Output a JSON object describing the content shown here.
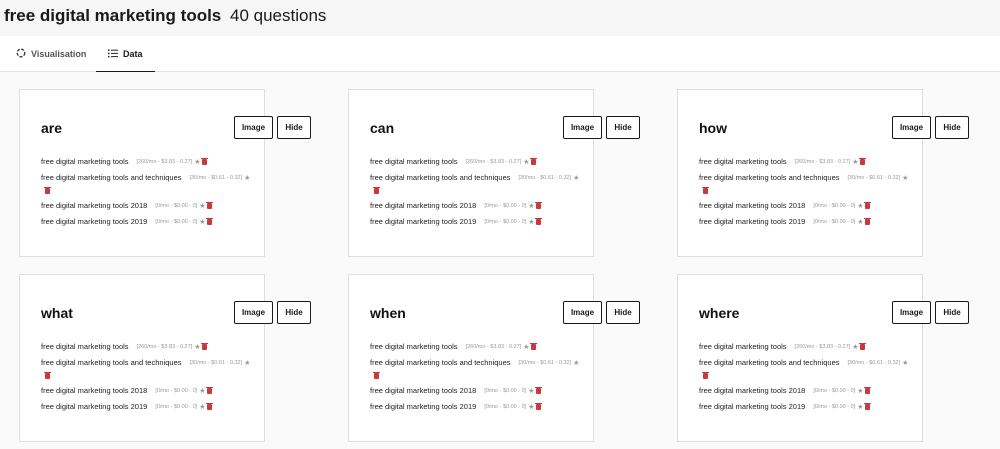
{
  "header": {
    "keyword": "free digital marketing tools",
    "count_label": "40 questions"
  },
  "tabs": [
    {
      "label": "Visualisation",
      "icon": "spinner-icon",
      "active": false
    },
    {
      "label": "Data",
      "icon": "list-icon",
      "active": true
    }
  ],
  "buttons": {
    "image": "Image",
    "hide": "Hide"
  },
  "cards": [
    {
      "title": "are",
      "rows": [
        {
          "text": "free digital marketing tools",
          "meta": "[260/mo - $3.83 - 0.27]"
        },
        {
          "text": "free digital marketing tools and techniques",
          "meta": "[30/mo - $0.61 - 0.32]"
        },
        {
          "text": "free digital marketing tools 2018",
          "meta": "[0/mo - $0.00 - 0]"
        },
        {
          "text": "free digital marketing tools 2019",
          "meta": "[0/mo - $0.00 - 0]"
        }
      ]
    },
    {
      "title": "can",
      "rows": [
        {
          "text": "free digital marketing tools",
          "meta": "[260/mo - $3.83 - 0.27]"
        },
        {
          "text": "free digital marketing tools and techniques",
          "meta": "[30/mo - $0.61 - 0.32]"
        },
        {
          "text": "free digital marketing tools 2018",
          "meta": "[0/mo - $0.00 - 0]"
        },
        {
          "text": "free digital marketing tools 2019",
          "meta": "[0/mo - $0.00 - 0]"
        }
      ]
    },
    {
      "title": "how",
      "rows": [
        {
          "text": "free digital marketing tools",
          "meta": "[260/mo - $3.83 - 0.27]"
        },
        {
          "text": "free digital marketing tools and techniques",
          "meta": "[30/mo - $0.61 - 0.32]"
        },
        {
          "text": "free digital marketing tools 2018",
          "meta": "[0/mo - $0.00 - 0]"
        },
        {
          "text": "free digital marketing tools 2019",
          "meta": "[0/mo - $0.00 - 0]"
        }
      ]
    },
    {
      "title": "what",
      "rows": [
        {
          "text": "free digital marketing tools",
          "meta": "[260/mo - $3.83 - 0.27]"
        },
        {
          "text": "free digital marketing tools and techniques",
          "meta": "[30/mo - $0.61 - 0.32]"
        },
        {
          "text": "free digital marketing tools 2018",
          "meta": "[0/mo - $0.00 - 0]"
        },
        {
          "text": "free digital marketing tools 2019",
          "meta": "[0/mo - $0.00 - 0]"
        }
      ]
    },
    {
      "title": "when",
      "rows": [
        {
          "text": "free digital marketing tools",
          "meta": "[260/mo - $3.83 - 0.27]"
        },
        {
          "text": "free digital marketing tools and techniques",
          "meta": "[30/mo - $0.61 - 0.32]"
        },
        {
          "text": "free digital marketing tools 2018",
          "meta": "[0/mo - $0.00 - 0]"
        },
        {
          "text": "free digital marketing tools 2019",
          "meta": "[0/mo - $0.00 - 0]"
        }
      ]
    },
    {
      "title": "where",
      "rows": [
        {
          "text": "free digital marketing tools",
          "meta": "[260/mo - $3.83 - 0.27]"
        },
        {
          "text": "free digital marketing tools and techniques",
          "meta": "[30/mo - $0.61 - 0.32]"
        },
        {
          "text": "free digital marketing tools 2018",
          "meta": "[0/mo - $0.00 - 0]"
        },
        {
          "text": "free digital marketing tools 2019",
          "meta": "[0/mo - $0.00 - 0]"
        }
      ]
    }
  ]
}
